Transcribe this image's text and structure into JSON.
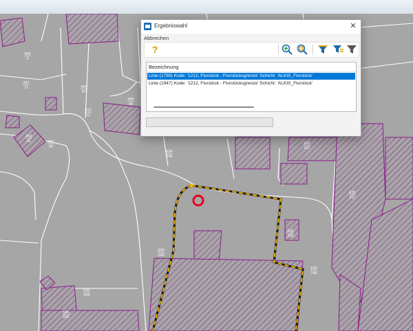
{
  "dialog": {
    "title": "Ergebniswahl",
    "close_glyph": "✕",
    "menu": {
      "cancel_label": "Abbrechen"
    },
    "toolbar": {
      "help_glyph": "?",
      "buttons": [
        "help-icon",
        "zoom-in-icon",
        "zoom-extent-icon",
        "filter-icon",
        "filter-add-icon",
        "filter-clear-icon"
      ]
    },
    "list": {
      "header": "Bezeichnung",
      "rows": [
        {
          "text": "Linie (1789) Kode: '1212, Flurstück - Flurstücksgrenze' Schicht: 'ALKIS_Flurstück'",
          "selected": true
        },
        {
          "text": "Linie (1947) Kode: '1212, Flurstück - Flurstücksgrenze' Schicht: 'ALKIS_Flurstück'",
          "selected": false
        }
      ]
    },
    "progress": 0
  },
  "map": {
    "colors": {
      "background": "#a6a6a6",
      "parcel_line": "#ffffff",
      "building": "#8b1a8b",
      "selection": "#f0b400",
      "marker": "#e8001c"
    },
    "parcel_labels": [
      {
        "num": "466",
        "den": "3"
      },
      {
        "num": "407",
        "den": "71"
      },
      {
        "num": "407",
        "den": "87"
      },
      {
        "num": "466",
        "den": "46"
      },
      {
        "num": "622",
        "den": "12"
      },
      {
        "num": "407",
        "den": "60"
      },
      {
        "num": "466",
        "den": "41"
      },
      {
        "num": "630",
        "den": "208"
      },
      {
        "num": "630",
        "den": "207"
      },
      {
        "num": "630",
        "den": "204"
      },
      {
        "num": "630",
        "den": "205"
      },
      {
        "num": "630",
        "den": "211"
      },
      {
        "num": "630",
        "den": "196"
      },
      {
        "num": "630",
        "den": "209"
      },
      {
        "num": "630",
        "den": "203"
      }
    ]
  }
}
